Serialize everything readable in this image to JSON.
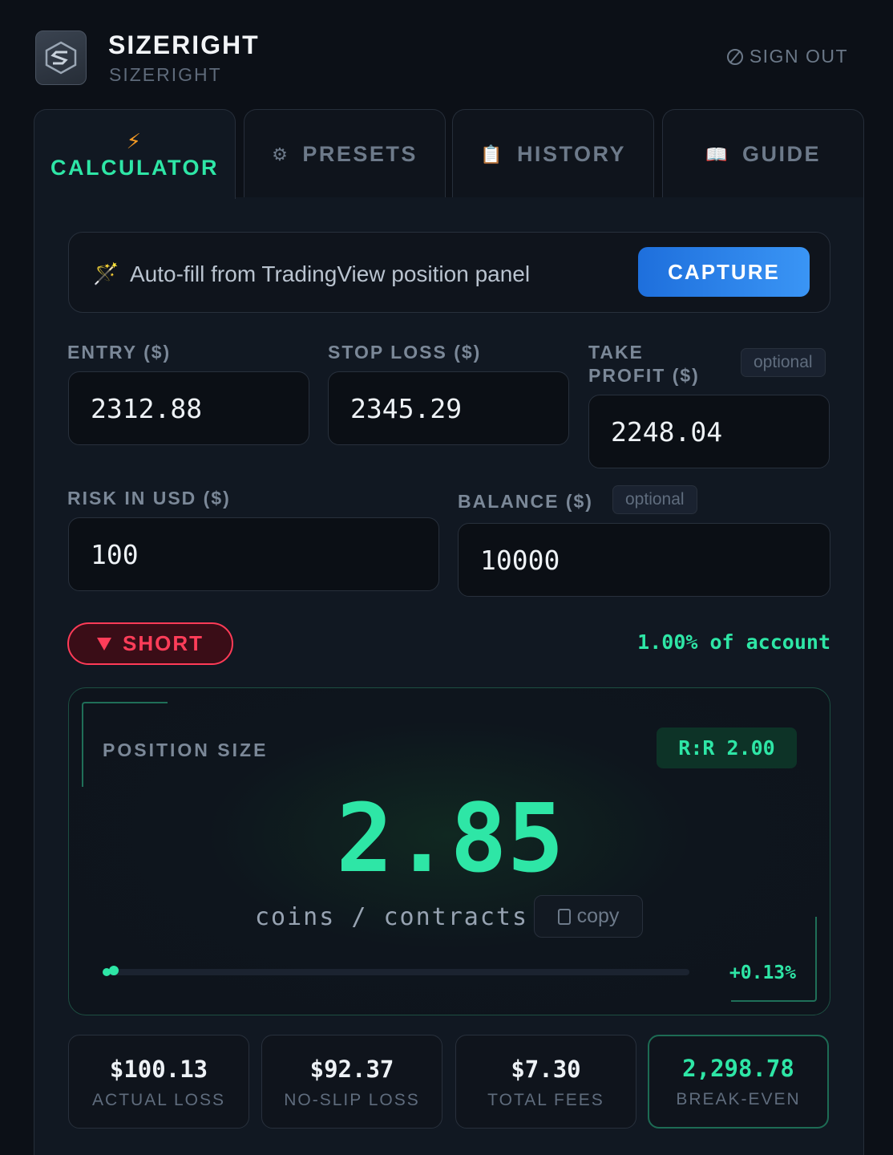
{
  "app": {
    "title": "SIZERIGHT",
    "subtitle": "SIZERIGHT",
    "signout_label": "SIGN OUT"
  },
  "tabs": [
    {
      "label": "CALCULATOR",
      "icon": "lightning-icon",
      "active": true
    },
    {
      "label": "PRESETS",
      "icon": "gear-icon",
      "active": false
    },
    {
      "label": "HISTORY",
      "icon": "clipboard-icon",
      "active": false
    },
    {
      "label": "GUIDE",
      "icon": "book-icon",
      "active": false
    }
  ],
  "autofill": {
    "text": "Auto-fill from TradingView position panel",
    "button_label": "CAPTURE"
  },
  "fields": {
    "entry": {
      "label": "ENTRY ($)",
      "value": "2312.88"
    },
    "stop_loss": {
      "label": "STOP LOSS ($)",
      "value": "2345.29"
    },
    "take_profit": {
      "label_line1": "TAKE",
      "label_line2": "PROFIT ($)",
      "value": "2248.04",
      "badge": "optional"
    },
    "risk": {
      "label": "RISK IN USD ($)",
      "value": "100"
    },
    "balance": {
      "label": "BALANCE ($)",
      "value": "10000",
      "badge": "optional"
    }
  },
  "direction": {
    "label": "SHORT",
    "account_pct": "1.00% of account"
  },
  "result": {
    "label": "POSITION SIZE",
    "rr": "R:R 2.00",
    "size": "2.85",
    "unit": "coins / contracts",
    "copy_label": "copy",
    "move_pct": "+0.13%",
    "progress_fraction": 0.013
  },
  "stats": [
    {
      "value": "$100.13",
      "label": "ACTUAL LOSS"
    },
    {
      "value": "$92.37",
      "label": "NO-SLIP LOSS"
    },
    {
      "value": "$7.30",
      "label": "TOTAL FEES"
    },
    {
      "value": "2,298.78",
      "label": "BREAK-EVEN"
    }
  ],
  "colors": {
    "accent_green": "#2ee6a6",
    "short_red": "#ff3d59",
    "capture_blue": "#2a82ea",
    "background": "#0c1017"
  }
}
